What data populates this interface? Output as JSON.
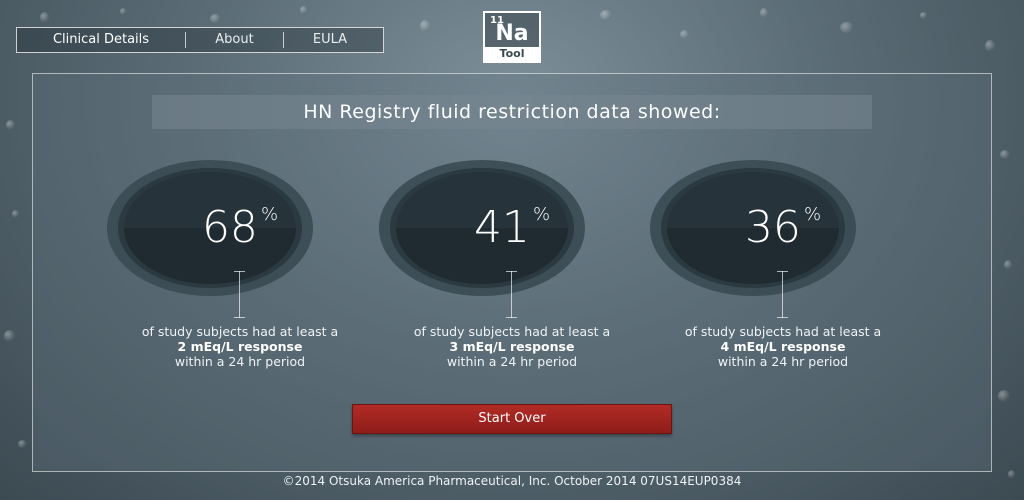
{
  "nav": {
    "items": [
      {
        "label": "Clinical Details"
      },
      {
        "label": "About"
      },
      {
        "label": "EULA"
      }
    ]
  },
  "logo": {
    "number": "11",
    "symbol": "Na",
    "word": "Tool"
  },
  "heading": "HN Registry fluid restriction data showed:",
  "stats": [
    {
      "value": "68",
      "unit": "%",
      "line1": "of study subjects had at least a",
      "line2": "2 mEq/L response",
      "line3": "within a 24 hr period"
    },
    {
      "value": "41",
      "unit": "%",
      "line1": "of study subjects had at least a",
      "line2": "3 mEq/L response",
      "line3": "within a 24 hr period"
    },
    {
      "value": "36",
      "unit": "%",
      "line1": "of study subjects had at least a",
      "line2": "4 mEq/L response",
      "line3": "within a 24 hr period"
    }
  ],
  "start_over_label": "Start Over",
  "footer": "©2014 Otsuka America Pharmaceutical, Inc. October 2014   07US14EUP0384",
  "colors": {
    "accent_red": "#a3231f",
    "circle_dark": "#2a363c",
    "ring": "#3e4f57"
  }
}
